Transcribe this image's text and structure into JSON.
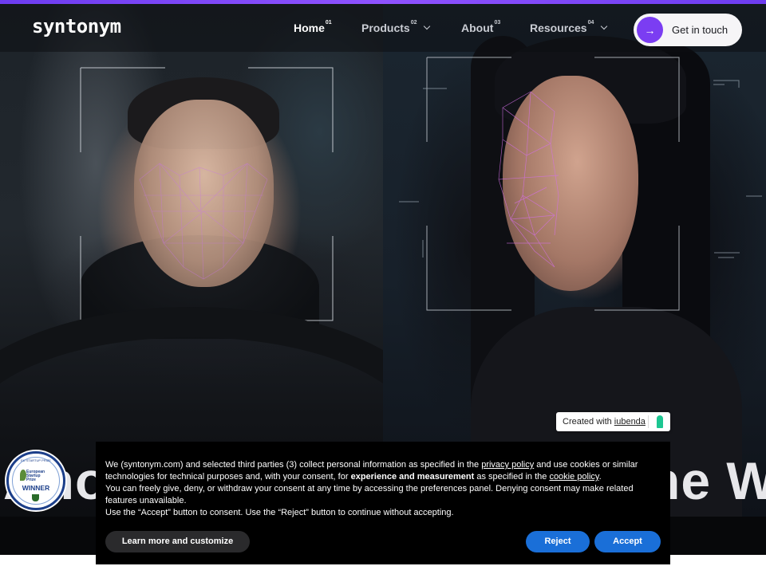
{
  "brand": {
    "logo_text": "syntonym",
    "accent_color": "#7b3df2"
  },
  "nav": {
    "items": [
      {
        "label": "Home",
        "index": "01",
        "active": true
      },
      {
        "label": "Products",
        "index": "02",
        "has_dropdown": true
      },
      {
        "label": "About",
        "index": "03"
      },
      {
        "label": "Resources",
        "index": "04",
        "has_dropdown": true
      }
    ],
    "cta_label": "Get in touch",
    "cta_icon": "arrow-right-icon"
  },
  "hero": {
    "heading_left": "Ano",
    "heading_right": "ne W"
  },
  "award": {
    "top_text": "EU STARTUP PRIZE",
    "prize_lines": [
      "European",
      "Startup",
      "Prize"
    ],
    "status": "WINNER"
  },
  "iubenda": {
    "prefix": "Created with",
    "link": "iubenda"
  },
  "cookie": {
    "line1_a": "We (syntonym.com) and selected third parties (3) collect personal information as specified in the ",
    "privacy_link": "privacy policy",
    "line1_b": " and use cookies or similar technologies for technical purposes and, with your consent, for ",
    "bold_text": "experience and measurement",
    "line1_c": " as specified in the ",
    "cookie_link": "cookie policy",
    "line1_d": ".",
    "line2": "You can freely give, deny, or withdraw your consent at any time by accessing the preferences panel. Denying consent may make related features unavailable.",
    "line3": "Use the “Accept” button to consent. Use the “Reject” button to continue without accepting.",
    "customize_label": "Learn more and customize",
    "reject_label": "Reject",
    "accept_label": "Accept",
    "button_color": "#1a6fd8"
  }
}
